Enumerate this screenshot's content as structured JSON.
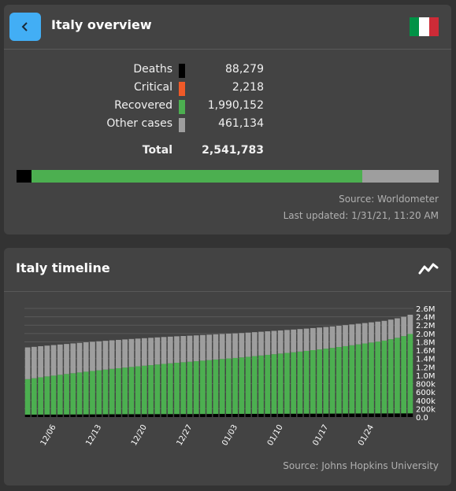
{
  "overview": {
    "title": "Italy overview",
    "back_icon": "chevron-left-icon",
    "flag_colors": [
      "#009246",
      "#ffffff",
      "#ce2b37"
    ],
    "stats": [
      {
        "label": "Deaths",
        "value": "88,279",
        "color": "#000000"
      },
      {
        "label": "Critical",
        "value": "2,218",
        "color": "#f05a28"
      },
      {
        "label": "Recovered",
        "value": "1,990,152",
        "color": "#4caf50"
      },
      {
        "label": "Other cases",
        "value": "461,134",
        "color": "#9e9e9e"
      }
    ],
    "total": {
      "label": "Total",
      "value": "2,541,783"
    },
    "source": "Source: Worldometer",
    "last_updated": "Last updated: 1/31/21, 11:20 AM"
  },
  "timeline": {
    "title": "Italy timeline",
    "icon": "trend-line-icon",
    "source": "Source: Johns Hopkins University"
  },
  "chart_data": {
    "type": "bar",
    "stacked": true,
    "x": [
      "12/02",
      "12/03",
      "12/04",
      "12/05",
      "12/06",
      "12/07",
      "12/08",
      "12/09",
      "12/10",
      "12/11",
      "12/12",
      "12/13",
      "12/14",
      "12/15",
      "12/16",
      "12/17",
      "12/18",
      "12/19",
      "12/20",
      "12/21",
      "12/22",
      "12/23",
      "12/24",
      "12/25",
      "12/26",
      "12/27",
      "12/28",
      "12/29",
      "12/30",
      "12/31",
      "01/01",
      "01/02",
      "01/03",
      "01/04",
      "01/05",
      "01/06",
      "01/07",
      "01/08",
      "01/09",
      "01/10",
      "01/11",
      "01/12",
      "01/13",
      "01/14",
      "01/15",
      "01/16",
      "01/17",
      "01/18",
      "01/19",
      "01/20",
      "01/21",
      "01/22",
      "01/23",
      "01/24",
      "01/25",
      "01/26",
      "01/27",
      "01/28",
      "01/29",
      "01/30"
    ],
    "tick_labels": [
      "12/06",
      "12/13",
      "12/20",
      "12/27",
      "01/03",
      "01/10",
      "01/17",
      "01/24"
    ],
    "series": [
      {
        "color": "#000000",
        "values": [
          57045,
          57760,
          58752,
          59514,
          60078,
          60606,
          61240,
          61739,
          62626,
          63387,
          63940,
          64520,
          65011,
          65857,
          66537,
          67220,
          67894,
          68447,
          68799,
          69214,
          69842,
          70395,
          70900,
          71359,
          71620,
          71925,
          72370,
          73029,
          73604,
          74159,
          74621,
          74985,
          75332,
          75680,
          76329,
          76877,
          77291,
          77911,
          78394,
          78755,
          79203,
          79819,
          80326,
          80848,
          81325,
          81800,
          82177,
          82554,
          83157,
          83681,
          84202,
          84674,
          85162,
          85461,
          85881,
          86422,
          86889,
          87381,
          87858,
          88279
        ]
      },
      {
        "color": "#4caf50",
        "values": [
          850000,
          871000,
          893000,
          913000,
          932000,
          951000,
          969000,
          987000,
          1004000,
          1022000,
          1039000,
          1055000,
          1071000,
          1087000,
          1102000,
          1117000,
          1132000,
          1146000,
          1160000,
          1174000,
          1188000,
          1202000,
          1215000,
          1228000,
          1240000,
          1252000,
          1264000,
          1277000,
          1290000,
          1303000,
          1315000,
          1327000,
          1339000,
          1352000,
          1366000,
          1381000,
          1396000,
          1411000,
          1426000,
          1441000,
          1456000,
          1471000,
          1487000,
          1503000,
          1520000,
          1537000,
          1555000,
          1573000,
          1593000,
          1613000,
          1634000,
          1655000,
          1676000,
          1698000,
          1720000,
          1743000,
          1776000,
          1810000,
          1850000,
          1900000
        ]
      },
      {
        "color": "#9e9e9e",
        "values": [
          760000,
          752000,
          744000,
          737000,
          731000,
          725000,
          719000,
          714000,
          709000,
          704000,
          699000,
          694000,
          689000,
          684000,
          679000,
          674000,
          669000,
          664000,
          659000,
          654000,
          649000,
          644000,
          639000,
          634000,
          629000,
          624000,
          619000,
          614000,
          609000,
          604000,
          599000,
          594000,
          589000,
          584000,
          579000,
          574000,
          569000,
          564000,
          559000,
          554000,
          549000,
          544000,
          539000,
          534000,
          529000,
          524000,
          519000,
          514000,
          509000,
          504000,
          499000,
          494000,
          489000,
          484000,
          479000,
          474000,
          470000,
          466000,
          463000,
          461134
        ]
      }
    ],
    "y_ticks": [
      "0.0",
      "200k",
      "400k",
      "600k",
      "800k",
      "1.0M",
      "1.2M",
      "1.4M",
      "1.6M",
      "1.8M",
      "2.0M",
      "2.2M",
      "2.4M",
      "2.6M"
    ],
    "ylim": [
      0,
      2600000
    ],
    "grid": true
  }
}
